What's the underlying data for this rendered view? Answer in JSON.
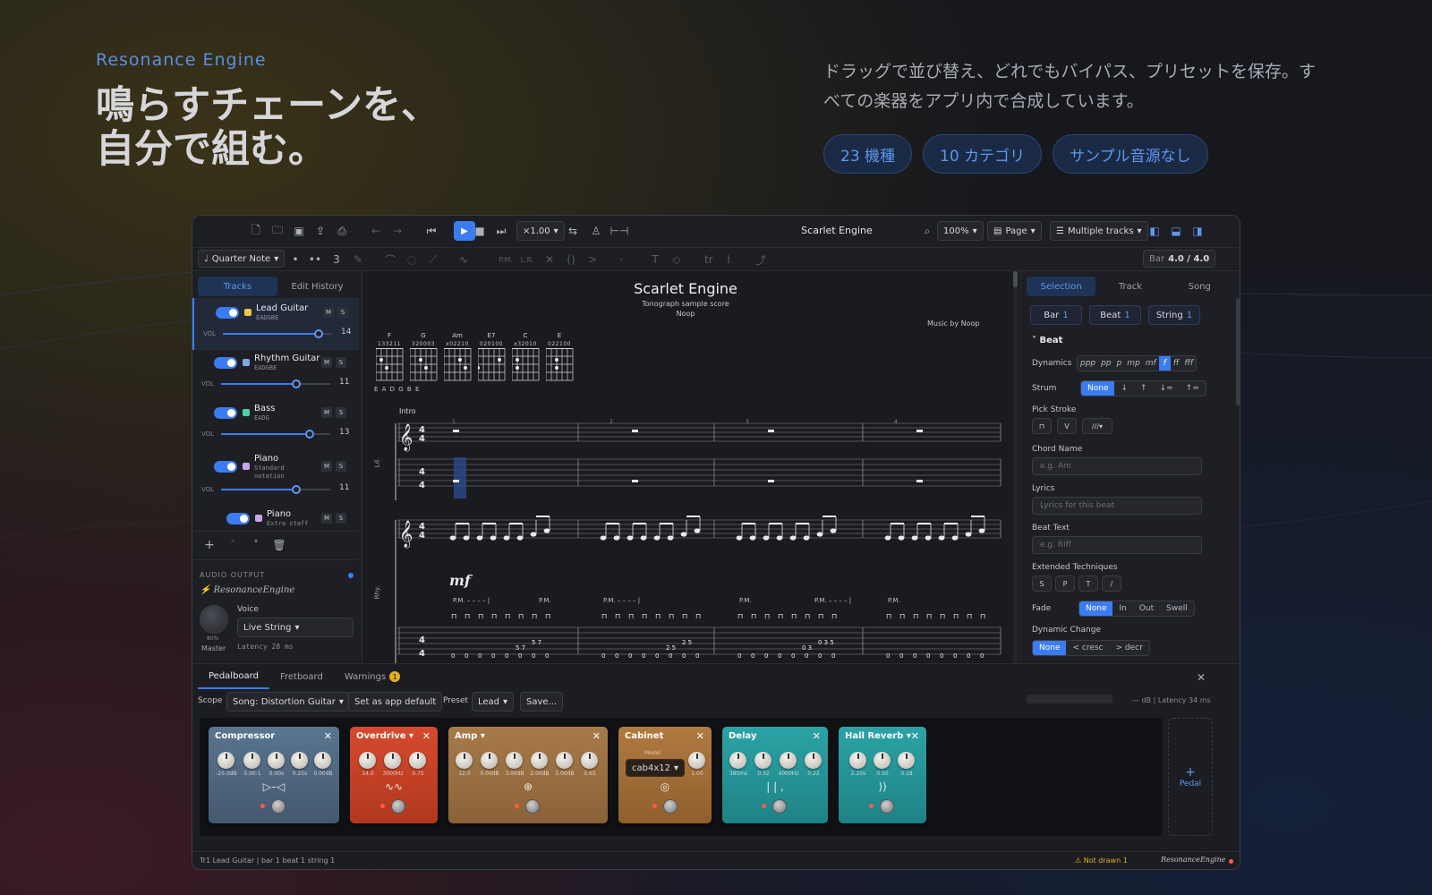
{
  "hero": {
    "tag": "Resonance Engine",
    "title_line1": "鳴らすチェーンを、",
    "title_line2": "自分で組む。",
    "desc": "ドラッグで並び替え、どれでもバイパス、プリセットを保存。すべての楽器をアプリ内で合成しています。",
    "badges": [
      "23 機種",
      "10 カテゴリ",
      "サンプル音源なし"
    ]
  },
  "toolbar": {
    "speed": "×1.00",
    "title": "Scarlet Engine",
    "zoom": "100%",
    "view": "Page",
    "tracks_mode": "Multiple tracks"
  },
  "toolbar2": {
    "duration": "Quarter Note",
    "tuplet": "3",
    "pm": "P.M.",
    "lr": "L.R.",
    "bar_label": "Bar",
    "bar_value": "4.0 / 4.0"
  },
  "sidebar": {
    "tabs": [
      "Tracks",
      "Edit History"
    ],
    "tracks": [
      {
        "name": "Lead Guitar",
        "tuning": "EADGBE",
        "vol": "14",
        "color": "#e6c84a"
      },
      {
        "name": "Rhythm Guitar",
        "tuning": "EADGBE",
        "vol": "11",
        "color": "#7fa6e8"
      },
      {
        "name": "Bass",
        "tuning": "EADG",
        "vol": "13",
        "color": "#4fd0a8"
      },
      {
        "name": "Piano",
        "tuning": "Standard",
        "tuning2": "notation",
        "vol": "11",
        "color": "#c9a4e8"
      },
      {
        "name": "Piano",
        "tuning": "Extra staff",
        "color": "#c9a4e8"
      }
    ],
    "vol_label": "VOL",
    "m": "M",
    "s": "S",
    "audio_output": "AUDIO OUTPUT",
    "engine": "ResonanceEngine",
    "voice_label": "Voice",
    "voice_value": "Live String",
    "latency": "Latency 28 ms",
    "master_pct": "80%",
    "master_label": "Master"
  },
  "score": {
    "title": "Scarlet Engine",
    "subtitle": "Tonograph sample score",
    "author": "Noop",
    "credit": "Music by Noop",
    "chords": [
      "F",
      "G",
      "Am",
      "E7",
      "C",
      "E"
    ],
    "chord_frets": [
      "133211",
      "320003",
      "x02210",
      "020100",
      "x32010",
      "022100"
    ],
    "tuning": "E A D G B E",
    "section": "Intro",
    "dynamic": "mf",
    "pm": "P.M.",
    "ts": "4",
    "track_lbl1": "Ld.",
    "track_lbl2": "Rhy.",
    "bar_nums": [
      "1",
      "2",
      "3",
      "4"
    ],
    "tab_rows": [
      {
        "a": "5 7",
        "b": "5 7",
        "c": "5 7"
      },
      {
        "a": "2 5",
        "b": "2 5",
        "c": "2 5"
      },
      {
        "a": "0 3 5",
        "b": "0 3",
        "c": "3 5"
      }
    ]
  },
  "right": {
    "tabs": [
      "Selection",
      "Track",
      "Song"
    ],
    "chips": [
      {
        "k": "Bar",
        "v": "1"
      },
      {
        "k": "Beat",
        "v": "1"
      },
      {
        "k": "String",
        "v": "1"
      }
    ],
    "section": "Beat",
    "dynamics_label": "Dynamics",
    "dynamics": [
      "ppp",
      "pp",
      "p",
      "mp",
      "mf",
      "f",
      "ff",
      "fff"
    ],
    "strum_label": "Strum",
    "strum": [
      "None",
      "↓",
      "↑",
      "↓≈",
      "↑≈"
    ],
    "pick_label": "Pick Stroke",
    "chord_label": "Chord Name",
    "chord_ph": "e.g. Am",
    "lyrics_label": "Lyrics",
    "lyrics_ph": "Lyrics for this beat",
    "beattext_label": "Beat Text",
    "beattext_ph": "e.g. Riff",
    "ext_label": "Extended Techniques",
    "ext": [
      "S",
      "P",
      "T",
      "/"
    ],
    "fade_label": "Fade",
    "fade": [
      "None",
      "In",
      "Out",
      "Swell"
    ],
    "dynchange_label": "Dynamic Change",
    "dynchange": [
      "None",
      "< cresc",
      "> decr"
    ]
  },
  "bottom": {
    "tabs": [
      "Pedalboard",
      "Fretboard",
      "Warnings"
    ],
    "warn_count": "1",
    "scope_label": "Scope",
    "scope_value": "Song: Distortion Guitar",
    "set_default": "Set as app default",
    "preset_label": "Preset",
    "preset_value": "Lead",
    "save": "Save...",
    "meter": "— dB | Latency 34 ms",
    "add_pedal": "Pedal",
    "pedals": [
      {
        "name": "Compressor",
        "values": [
          "-25.0dB",
          "5.00:1",
          "0.00s",
          "0.25s",
          "0.00dB"
        ],
        "sym": "▷–◁"
      },
      {
        "name": "Overdrive",
        "values": [
          "14.0",
          "3000Hz",
          "0.75"
        ],
        "sym": "∿∿"
      },
      {
        "name": "Amp",
        "values": [
          "12.0",
          "0.00dB",
          "3.00dB",
          "2.00dB",
          "5.00dB",
          "0.65"
        ],
        "sym": "⊕"
      },
      {
        "name": "Cabinet",
        "model_label": "Model",
        "model": "cab4x12",
        "values": [
          "1.00"
        ],
        "sym": "◎"
      },
      {
        "name": "Delay",
        "values": [
          "380ms",
          "0.32",
          "4000Hz",
          "0.22"
        ],
        "sym": "| | ,"
      },
      {
        "name": "Hall Reverb",
        "values": [
          "2.20s",
          "0.50",
          "0.18"
        ],
        "sym": "))"
      }
    ]
  },
  "status": {
    "left": "Tr1 Lead Guitar | bar 1 beat 1 string 1",
    "warn": "⚠ Not drawn 1",
    "brand": "ResonanceEngine"
  }
}
